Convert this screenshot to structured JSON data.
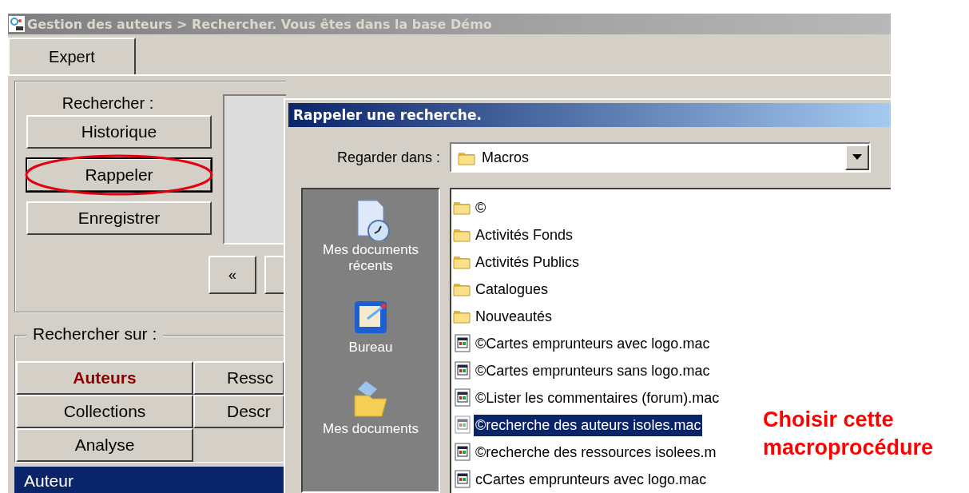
{
  "window": {
    "title": "Gestion des auteurs > Rechercher.  Vous êtes dans la base Démo"
  },
  "tabs": [
    {
      "label": "Expert",
      "selected": true
    }
  ],
  "search_panel": {
    "label": "Rechercher :",
    "buttons": [
      {
        "label": "Historique",
        "highlighted": false
      },
      {
        "label": "Rappeler",
        "highlighted": true
      },
      {
        "label": "Enregistrer",
        "highlighted": false
      }
    ],
    "nav_buttons": [
      "«"
    ]
  },
  "search_on": {
    "label": "Rechercher sur :",
    "buttons": [
      {
        "label": "Auteurs",
        "selected": true
      },
      {
        "label": "Ressc",
        "selected": false
      },
      {
        "label": "Collections",
        "selected": false
      },
      {
        "label": "Descr",
        "selected": false
      },
      {
        "label": "Analyse",
        "selected": false
      }
    ]
  },
  "results": {
    "rows": [
      {
        "label": "Auteur",
        "selected": true
      }
    ]
  },
  "dialog": {
    "title": "Rappeler une recherche.",
    "look_in_label": "Regarder dans :",
    "look_in_value": "Macros",
    "places": [
      {
        "label": "Mes documents récents",
        "kind": "recent"
      },
      {
        "label": "Bureau",
        "kind": "desktop"
      },
      {
        "label": "Mes documents",
        "kind": "documents"
      }
    ],
    "files": [
      {
        "name": "©",
        "kind": "folder",
        "selected": false
      },
      {
        "name": "Activités Fonds",
        "kind": "folder",
        "selected": false
      },
      {
        "name": "Activités Publics",
        "kind": "folder",
        "selected": false
      },
      {
        "name": "Catalogues",
        "kind": "folder",
        "selected": false
      },
      {
        "name": "Nouveautés",
        "kind": "folder",
        "selected": false
      },
      {
        "name": "©Cartes emprunteurs avec logo.mac",
        "kind": "macro",
        "selected": false
      },
      {
        "name": "©Cartes emprunteurs sans logo.mac",
        "kind": "macro",
        "selected": false
      },
      {
        "name": "©Lister les commentaires (forum).mac",
        "kind": "macro",
        "selected": false
      },
      {
        "name": "©recherche des auteurs isoles.mac",
        "kind": "macro",
        "selected": true
      },
      {
        "name": "©recherche des ressources isolees.m",
        "kind": "macro",
        "selected": false
      },
      {
        "name": "cCartes emprunteurs avec logo.mac",
        "kind": "macro",
        "selected": false
      }
    ]
  },
  "annotation": {
    "text": "Choisir cette macroprocédure"
  }
}
